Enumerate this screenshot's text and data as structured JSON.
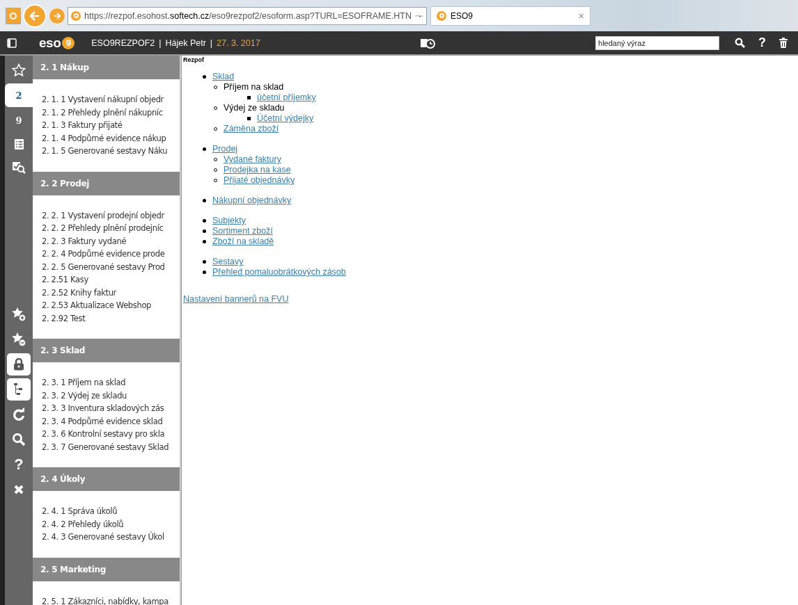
{
  "browser": {
    "url": "https://rezpof.esohost.**softech.cz**/eso9rezpof2/esoform.asp?TURL=ESOFRAME.HTN",
    "tab_title": "ESO9",
    "tab_close": "×"
  },
  "app_bar": {
    "logo": "eso",
    "logo_badge": "9",
    "database": "ESO9REZPOF2",
    "separator": "|",
    "user": "Hájek Petr",
    "separator_2": "|",
    "date": "27. 3. 2017",
    "search": {
      "placeholder": "hledaný výraz"
    },
    "help": "?"
  },
  "rail": {
    "tabs": [
      {
        "kind": "favorites",
        "selected": false
      },
      {
        "kind": "text",
        "label": "2",
        "selected": true
      },
      {
        "kind": "text",
        "label": "9",
        "selected": false
      },
      {
        "kind": "list",
        "selected": false
      },
      {
        "kind": "check",
        "selected": false
      }
    ],
    "tools": [
      {
        "kind": "star-add",
        "on": false
      },
      {
        "kind": "star-remove",
        "on": false
      },
      {
        "kind": "lock",
        "on": true
      },
      {
        "kind": "tree",
        "on": true
      },
      {
        "kind": "refresh",
        "on": false
      },
      {
        "kind": "search",
        "on": false
      },
      {
        "kind": "help",
        "label": "?",
        "on": false
      },
      {
        "kind": "close",
        "on": false
      }
    ]
  },
  "menu": [
    {
      "title": "2. 1 Nákup",
      "items": [
        "2. 1. 1 Vystavení nákupní objedr",
        "2. 1. 2 Přehledy plnění nákupníc",
        "2. 1. 3 Faktury přijaté",
        "2. 1. 4 Podpůrné evidence nákup",
        "2. 1. 5 Generované sestavy Náku"
      ]
    },
    {
      "title": "2. 2 Prodej",
      "items": [
        "2. 2. 1 Vystavení prodejní objedr",
        "2. 2. 2 Přehledy plnění prodejníc",
        "2. 2. 3 Faktury vydané",
        "2. 2. 4 Podpůrné evidence prode",
        "2. 2. 5 Generované sestavy Prod",
        "2. 2.51 Kasy",
        "2. 2.52 Knihy faktur",
        "2. 2.53 Aktualizace Webshop",
        "2. 2.92 Test"
      ]
    },
    {
      "title": "2. 3 Sklad",
      "items": [
        "2. 3. 1 Příjem na sklad",
        "2. 3. 2 Výdej ze skladu",
        "2. 3. 3 Inventura skladových zás",
        "2. 3. 4 Podpůrné evidence sklad",
        "2. 3. 6 Kontrolní sestavy pro skla",
        "2. 3. 7 Generované sestavy Sklad"
      ]
    },
    {
      "title": "2. 4 Úkoly",
      "items": [
        "2. 4. 1 Správa úkolů",
        "2. 4. 2 Přehledy úkolů",
        "2. 4. 3 Generované sestavy Úkol"
      ]
    },
    {
      "title": "2. 5 Marketing",
      "items": [
        "2. 5. 1 Zákazníci, nabídky, kampa"
      ]
    }
  ],
  "content": {
    "title": "Rezpof",
    "groups": [
      [
        {
          "label": "Sklad",
          "link": true,
          "children": [
            {
              "label": "Příjem na sklad",
              "link": false,
              "children": [
                {
                  "label": "účetní příjemky",
                  "link": true
                }
              ]
            },
            {
              "label": "Výdej ze skladu",
              "link": false,
              "children": [
                {
                  "label": "Účetní výdejky",
                  "link": true
                }
              ]
            },
            {
              "label": "Záměna zboží",
              "link": true
            }
          ]
        }
      ],
      [
        {
          "label": "Prodej",
          "link": true,
          "children": [
            {
              "label": "Vydané faktury",
              "link": true
            },
            {
              "label": "Prodejka na kase",
              "link": true
            },
            {
              "label": "Přijaté objednávky",
              "link": true
            }
          ]
        }
      ],
      [
        {
          "label": "Nákupní objednávky",
          "link": true
        }
      ],
      [
        {
          "label": "Subjekty",
          "link": true
        },
        {
          "label": "Sortiment zboží",
          "link": true
        },
        {
          "label": "Zboží na skladě",
          "link": true
        }
      ],
      [
        {
          "label": "Sestavy",
          "link": true
        },
        {
          "label": "Přehled pomaluobrátkových zásob",
          "link": true
        }
      ]
    ],
    "footer_link": "Nastavení bannerů na FVU"
  }
}
